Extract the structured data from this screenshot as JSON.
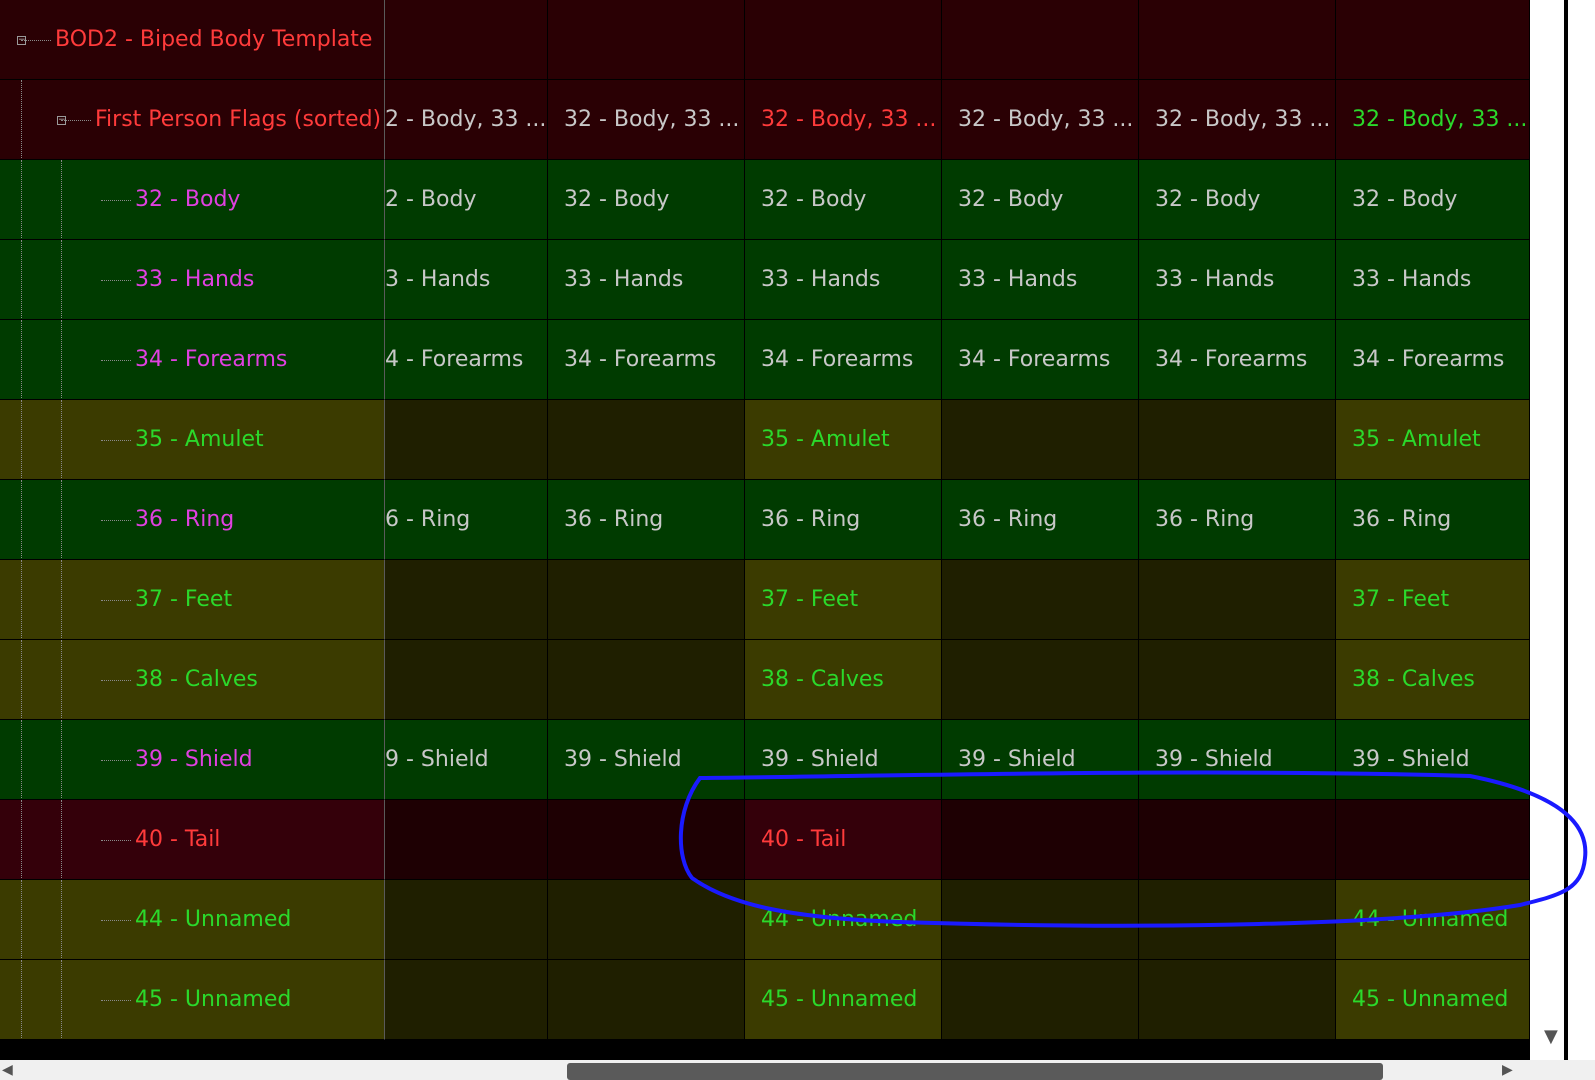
{
  "colors": {
    "bg_dark_red": "#2a0004",
    "bg_dark_red_alt": "#1e0003",
    "bg_dark_red_hi": "#34000a",
    "bg_green": "#003b00",
    "bg_olive": "#3b3b00",
    "bg_olive_dark": "#1f1f00",
    "text_red": "#ff3b3b",
    "text_magenta": "#e040e0",
    "text_green": "#2bd92b",
    "text_light": "#c8c8c8",
    "annotation_blue": "#1a1aff"
  },
  "rows": [
    {
      "label": "BOD2 - Biped Body Template",
      "label_color": "text_red",
      "bg": "bg_dark_red",
      "depth": 0,
      "expander": "−",
      "cells": [
        {
          "text": "",
          "color": "text_light",
          "bg": "bg_dark_red"
        },
        {
          "text": "",
          "color": "text_light",
          "bg": "bg_dark_red"
        },
        {
          "text": "",
          "color": "text_light",
          "bg": "bg_dark_red"
        },
        {
          "text": "",
          "color": "text_light",
          "bg": "bg_dark_red"
        },
        {
          "text": "",
          "color": "text_light",
          "bg": "bg_dark_red"
        },
        {
          "text": "",
          "color": "text_light",
          "bg": "bg_dark_red"
        }
      ]
    },
    {
      "label": "First Person Flags (sorted)",
      "label_color": "text_red",
      "bg": "bg_dark_red",
      "depth": 1,
      "expander": "−",
      "cells": [
        {
          "text": "2 - Body, 33 ...",
          "color": "text_light",
          "bg": "bg_dark_red"
        },
        {
          "text": "32 - Body, 33 ...",
          "color": "text_light",
          "bg": "bg_dark_red"
        },
        {
          "text": "32 - Body, 33 ...",
          "color": "text_red",
          "bg": "bg_dark_red"
        },
        {
          "text": "32 - Body, 33 ...",
          "color": "text_light",
          "bg": "bg_dark_red"
        },
        {
          "text": "32 - Body, 33 ...",
          "color": "text_light",
          "bg": "bg_dark_red"
        },
        {
          "text": "32 - Body, 33 ...",
          "color": "text_green",
          "bg": "bg_dark_red"
        }
      ]
    },
    {
      "label": "32 - Body",
      "label_color": "text_magenta",
      "bg": "bg_green",
      "depth": 2,
      "cells": [
        {
          "text": "2 - Body",
          "color": "text_light",
          "bg": "bg_green"
        },
        {
          "text": "32 - Body",
          "color": "text_light",
          "bg": "bg_green"
        },
        {
          "text": "32 - Body",
          "color": "text_light",
          "bg": "bg_green"
        },
        {
          "text": "32 - Body",
          "color": "text_light",
          "bg": "bg_green"
        },
        {
          "text": "32 - Body",
          "color": "text_light",
          "bg": "bg_green"
        },
        {
          "text": "32 - Body",
          "color": "text_light",
          "bg": "bg_green"
        }
      ]
    },
    {
      "label": "33 - Hands",
      "label_color": "text_magenta",
      "bg": "bg_green",
      "depth": 2,
      "cells": [
        {
          "text": "3 - Hands",
          "color": "text_light",
          "bg": "bg_green"
        },
        {
          "text": "33 - Hands",
          "color": "text_light",
          "bg": "bg_green"
        },
        {
          "text": "33 - Hands",
          "color": "text_light",
          "bg": "bg_green"
        },
        {
          "text": "33 - Hands",
          "color": "text_light",
          "bg": "bg_green"
        },
        {
          "text": "33 - Hands",
          "color": "text_light",
          "bg": "bg_green"
        },
        {
          "text": "33 - Hands",
          "color": "text_light",
          "bg": "bg_green"
        }
      ]
    },
    {
      "label": "34 - Forearms",
      "label_color": "text_magenta",
      "bg": "bg_green",
      "depth": 2,
      "cells": [
        {
          "text": "4 - Forearms",
          "color": "text_light",
          "bg": "bg_green"
        },
        {
          "text": "34 - Forearms",
          "color": "text_light",
          "bg": "bg_green"
        },
        {
          "text": "34 - Forearms",
          "color": "text_light",
          "bg": "bg_green"
        },
        {
          "text": "34 - Forearms",
          "color": "text_light",
          "bg": "bg_green"
        },
        {
          "text": "34 - Forearms",
          "color": "text_light",
          "bg": "bg_green"
        },
        {
          "text": "34 - Forearms",
          "color": "text_light",
          "bg": "bg_green"
        }
      ]
    },
    {
      "label": "35 - Amulet",
      "label_color": "text_green",
      "bg": "bg_olive",
      "depth": 2,
      "cells": [
        {
          "text": "",
          "color": "text_green",
          "bg": "bg_olive_dark"
        },
        {
          "text": "",
          "color": "text_green",
          "bg": "bg_olive_dark"
        },
        {
          "text": "35 - Amulet",
          "color": "text_green",
          "bg": "bg_olive"
        },
        {
          "text": "",
          "color": "text_green",
          "bg": "bg_olive_dark"
        },
        {
          "text": "",
          "color": "text_green",
          "bg": "bg_olive_dark"
        },
        {
          "text": "35 - Amulet",
          "color": "text_green",
          "bg": "bg_olive"
        }
      ]
    },
    {
      "label": "36 - Ring",
      "label_color": "text_magenta",
      "bg": "bg_green",
      "depth": 2,
      "cells": [
        {
          "text": "6 - Ring",
          "color": "text_light",
          "bg": "bg_green"
        },
        {
          "text": "36 - Ring",
          "color": "text_light",
          "bg": "bg_green"
        },
        {
          "text": "36 - Ring",
          "color": "text_light",
          "bg": "bg_green"
        },
        {
          "text": "36 - Ring",
          "color": "text_light",
          "bg": "bg_green"
        },
        {
          "text": "36 - Ring",
          "color": "text_light",
          "bg": "bg_green"
        },
        {
          "text": "36 - Ring",
          "color": "text_light",
          "bg": "bg_green"
        }
      ]
    },
    {
      "label": "37 - Feet",
      "label_color": "text_green",
      "bg": "bg_olive",
      "depth": 2,
      "cells": [
        {
          "text": "",
          "color": "text_green",
          "bg": "bg_olive_dark"
        },
        {
          "text": "",
          "color": "text_green",
          "bg": "bg_olive_dark"
        },
        {
          "text": "37 - Feet",
          "color": "text_green",
          "bg": "bg_olive"
        },
        {
          "text": "",
          "color": "text_green",
          "bg": "bg_olive_dark"
        },
        {
          "text": "",
          "color": "text_green",
          "bg": "bg_olive_dark"
        },
        {
          "text": "37 - Feet",
          "color": "text_green",
          "bg": "bg_olive"
        }
      ]
    },
    {
      "label": "38 - Calves",
      "label_color": "text_green",
      "bg": "bg_olive",
      "depth": 2,
      "cells": [
        {
          "text": "",
          "color": "text_green",
          "bg": "bg_olive_dark"
        },
        {
          "text": "",
          "color": "text_green",
          "bg": "bg_olive_dark"
        },
        {
          "text": "38 - Calves",
          "color": "text_green",
          "bg": "bg_olive"
        },
        {
          "text": "",
          "color": "text_green",
          "bg": "bg_olive_dark"
        },
        {
          "text": "",
          "color": "text_green",
          "bg": "bg_olive_dark"
        },
        {
          "text": "38 - Calves",
          "color": "text_green",
          "bg": "bg_olive"
        }
      ]
    },
    {
      "label": "39 - Shield",
      "label_color": "text_magenta",
      "bg": "bg_green",
      "depth": 2,
      "cells": [
        {
          "text": "9 - Shield",
          "color": "text_light",
          "bg": "bg_green"
        },
        {
          "text": "39 - Shield",
          "color": "text_light",
          "bg": "bg_green"
        },
        {
          "text": "39 - Shield",
          "color": "text_light",
          "bg": "bg_green"
        },
        {
          "text": "39 - Shield",
          "color": "text_light",
          "bg": "bg_green"
        },
        {
          "text": "39 - Shield",
          "color": "text_light",
          "bg": "bg_green"
        },
        {
          "text": "39 - Shield",
          "color": "text_light",
          "bg": "bg_green"
        }
      ]
    },
    {
      "label": "40 - Tail",
      "label_color": "text_red",
      "bg": "bg_dark_red_hi",
      "depth": 2,
      "cells": [
        {
          "text": "",
          "color": "text_red",
          "bg": "bg_dark_red_alt"
        },
        {
          "text": "",
          "color": "text_red",
          "bg": "bg_dark_red_alt"
        },
        {
          "text": "40 - Tail",
          "color": "text_red",
          "bg": "bg_dark_red_hi"
        },
        {
          "text": "",
          "color": "text_red",
          "bg": "bg_dark_red_alt"
        },
        {
          "text": "",
          "color": "text_red",
          "bg": "bg_dark_red_alt"
        },
        {
          "text": "",
          "color": "text_red",
          "bg": "bg_dark_red_alt"
        }
      ]
    },
    {
      "label": "44 - Unnamed",
      "label_color": "text_green",
      "bg": "bg_olive",
      "depth": 2,
      "cells": [
        {
          "text": "",
          "color": "text_green",
          "bg": "bg_olive_dark"
        },
        {
          "text": "",
          "color": "text_green",
          "bg": "bg_olive_dark"
        },
        {
          "text": "44 - Unnamed",
          "color": "text_green",
          "bg": "bg_olive"
        },
        {
          "text": "",
          "color": "text_green",
          "bg": "bg_olive_dark"
        },
        {
          "text": "",
          "color": "text_green",
          "bg": "bg_olive_dark"
        },
        {
          "text": "44 - Unnamed",
          "color": "text_green",
          "bg": "bg_olive"
        }
      ]
    },
    {
      "label": "45 - Unnamed",
      "label_color": "text_green",
      "bg": "bg_olive",
      "depth": 2,
      "cells": [
        {
          "text": "",
          "color": "text_green",
          "bg": "bg_olive_dark"
        },
        {
          "text": "",
          "color": "text_green",
          "bg": "bg_olive_dark"
        },
        {
          "text": "45 - Unnamed",
          "color": "text_green",
          "bg": "bg_olive"
        },
        {
          "text": "",
          "color": "text_green",
          "bg": "bg_olive_dark"
        },
        {
          "text": "",
          "color": "text_green",
          "bg": "bg_olive_dark"
        },
        {
          "text": "45 - Unnamed",
          "color": "text_green",
          "bg": "bg_olive"
        }
      ]
    }
  ],
  "icons": {
    "scroll_down": "triangle-down-icon",
    "scroll_left": "triangle-left-icon",
    "scroll_right": "triangle-right-icon"
  }
}
